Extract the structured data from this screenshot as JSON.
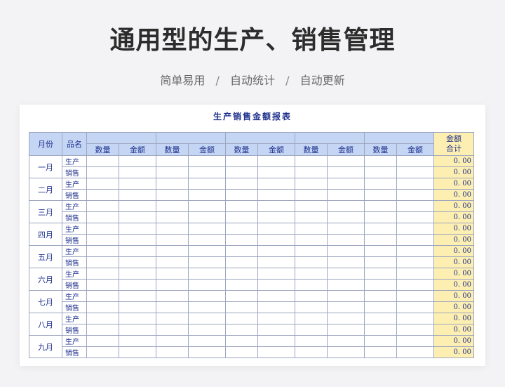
{
  "page": {
    "title": "通用型的生产、销售管理",
    "subtitle": [
      "简单易用",
      "自动统计",
      "自动更新"
    ],
    "separator": "/"
  },
  "sheet": {
    "title": "生产销售金额报表",
    "headers": {
      "month": "月份",
      "product": "品名",
      "quantity": "数量",
      "amount": "金额",
      "total_line1": "金额",
      "total_line2": "合计"
    },
    "product_rows": [
      "生产",
      "销售"
    ],
    "months": [
      "一月",
      "二月",
      "三月",
      "四月",
      "五月",
      "六月",
      "七月",
      "八月",
      "九月"
    ],
    "group_count": 5,
    "total_value": "0. 00"
  }
}
